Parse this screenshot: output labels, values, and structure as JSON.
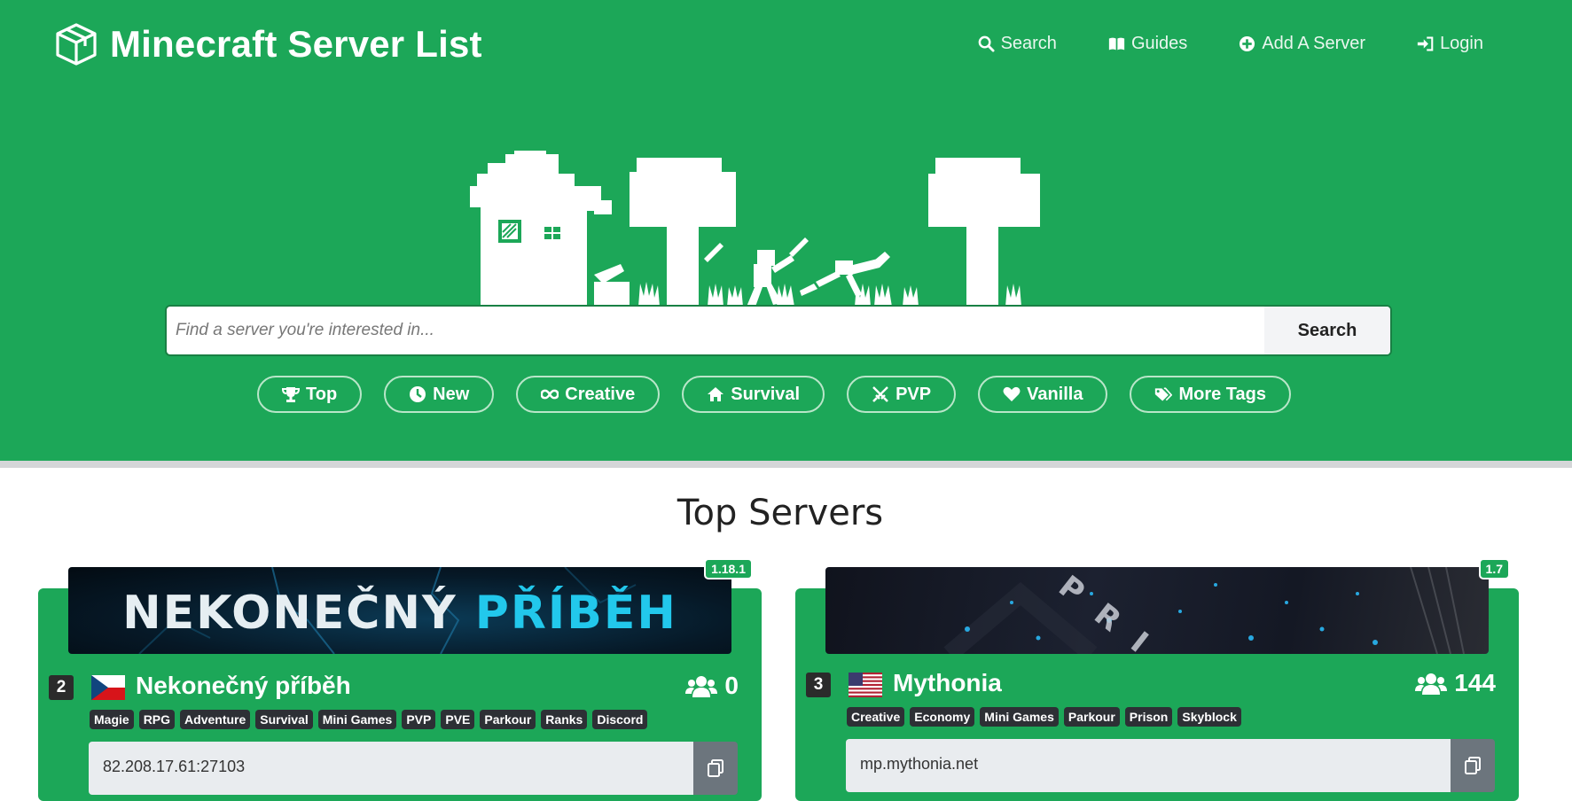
{
  "brand": {
    "title": "Minecraft Server List"
  },
  "nav": [
    {
      "label": "Search",
      "icon": "search-icon"
    },
    {
      "label": "Guides",
      "icon": "book-icon"
    },
    {
      "label": "Add A Server",
      "icon": "plus-circle-icon"
    },
    {
      "label": "Login",
      "icon": "sign-in-icon"
    }
  ],
  "search": {
    "placeholder": "Find a server you're interested in...",
    "button": "Search"
  },
  "tags": [
    {
      "label": "Top",
      "icon": "trophy-icon"
    },
    {
      "label": "New",
      "icon": "clock-icon"
    },
    {
      "label": "Creative",
      "icon": "infinity-icon"
    },
    {
      "label": "Survival",
      "icon": "home-icon"
    },
    {
      "label": "PVP",
      "icon": "swords-icon"
    },
    {
      "label": "Vanilla",
      "icon": "heart-icon"
    },
    {
      "label": "More Tags",
      "icon": "tags-icon"
    }
  ],
  "section_title": "Top Servers",
  "servers": [
    {
      "rank": "2",
      "flag": "Czech Republic",
      "name": "Nekonečný příběh",
      "players": "0",
      "version": "1.18.1",
      "banner_text_1": "NEKONEČNÝ ",
      "banner_text_2": "PŘÍBĚH",
      "tags": [
        "Magie",
        "RPG",
        "Adventure",
        "Survival",
        "Mini Games",
        "PVP",
        "PVE",
        "Parkour",
        "Ranks",
        "Discord"
      ],
      "ip": "82.208.17.61:27103"
    },
    {
      "rank": "3",
      "flag": "United States",
      "name": "Mythonia",
      "players": "144",
      "version": "1.7",
      "banner_text": "PRISON",
      "tags": [
        "Creative",
        "Economy",
        "Mini Games",
        "Parkour",
        "Prison",
        "Skyblock"
      ],
      "ip": "mp.mythonia.net"
    }
  ],
  "colors": {
    "hero": "#1ca758",
    "chip": "#2d3035",
    "accent": "#22c8ec"
  }
}
